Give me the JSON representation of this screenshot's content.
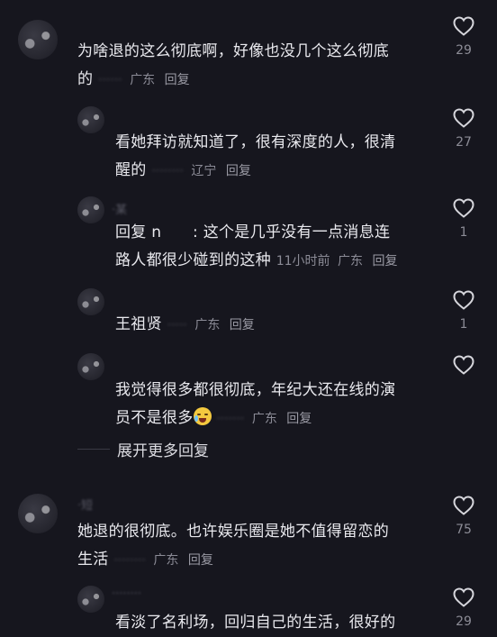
{
  "comments": [
    {
      "username": "·",
      "line1": "为啥退的这么彻底啊，好像也没几个这么彻底",
      "line2": "的",
      "time": "",
      "region": "广东",
      "reply": "回复",
      "likes": "29"
    },
    {
      "username": "",
      "line1": "看她拜访就知道了，很有深度的人，很清",
      "line2": "醒的",
      "time": "",
      "region": "辽宁",
      "reply": "回复",
      "likes": "27"
    },
    {
      "username": "·某",
      "line1": "回复 n　　: 这个是几乎没有一点消息连",
      "line2": "路人都很少碰到的这种",
      "time": "11小时前",
      "region": "广东",
      "reply": "回复",
      "likes": "1"
    },
    {
      "username": "",
      "line1": "王祖贤",
      "line2": "",
      "time": "",
      "region": "广东",
      "reply": "回复",
      "likes": "1"
    },
    {
      "username": "",
      "line1": "我觉得很多都很彻底，年纪大还在线的演",
      "line2": "员不是很多",
      "time": "",
      "region": "广东",
      "reply": "回复",
      "likes": ""
    },
    {
      "username": "·短",
      "line1": "她退的很彻底。也许娱乐圈是她不值得留恋的",
      "line2": "生活",
      "time": "",
      "region": "广东",
      "reply": "回复",
      "likes": "75"
    },
    {
      "username": "",
      "line1": "看淡了名利场，回归自己的生活，很好的",
      "line2": "",
      "time": "",
      "region": "",
      "reply": "",
      "likes": "29"
    }
  ],
  "expand_label": "展开更多回复",
  "colors": {
    "background": "#16161e",
    "text": "#e9e9ee",
    "meta": "#8b8b96"
  },
  "icons": {
    "like": "heart-outline-icon",
    "emoji": "laughing-crying-emoji"
  }
}
